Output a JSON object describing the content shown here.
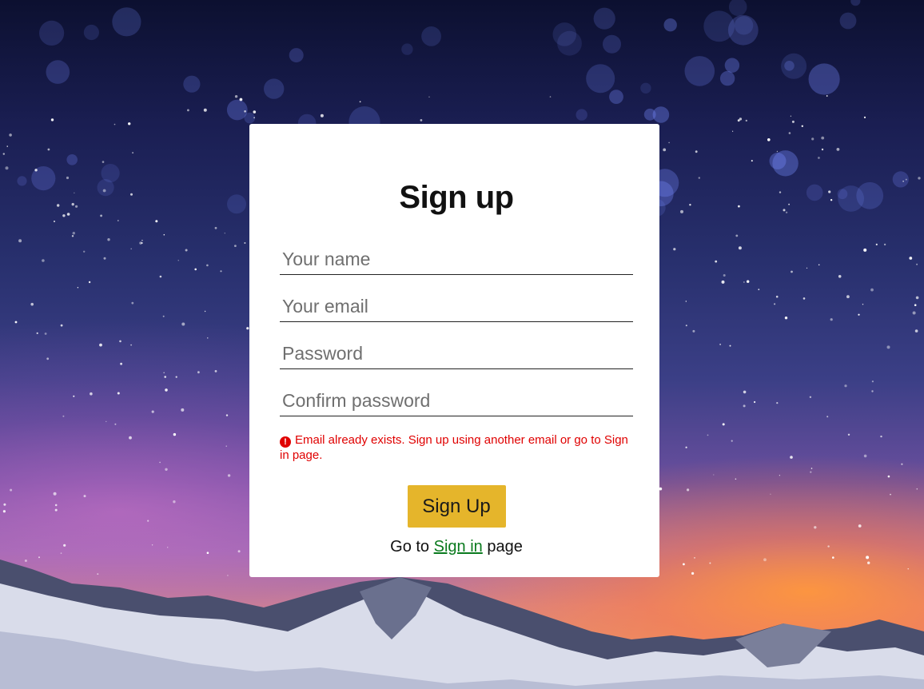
{
  "form": {
    "title": "Sign up",
    "name_placeholder": "Your name",
    "email_placeholder": "Your email",
    "password_placeholder": "Password",
    "confirm_placeholder": "Confirm password",
    "error_message": "Email already exists. Sign up using another email or go to Sign in page.",
    "submit_label": "Sign Up",
    "goto_prefix": "Go to",
    "signin_link": "Sign in",
    "goto_suffix": "page"
  },
  "colors": {
    "button": "#e5b52b",
    "error": "#e00000",
    "link": "#0a7a1e"
  },
  "icons": {
    "error": "exclamation-circle-icon"
  }
}
